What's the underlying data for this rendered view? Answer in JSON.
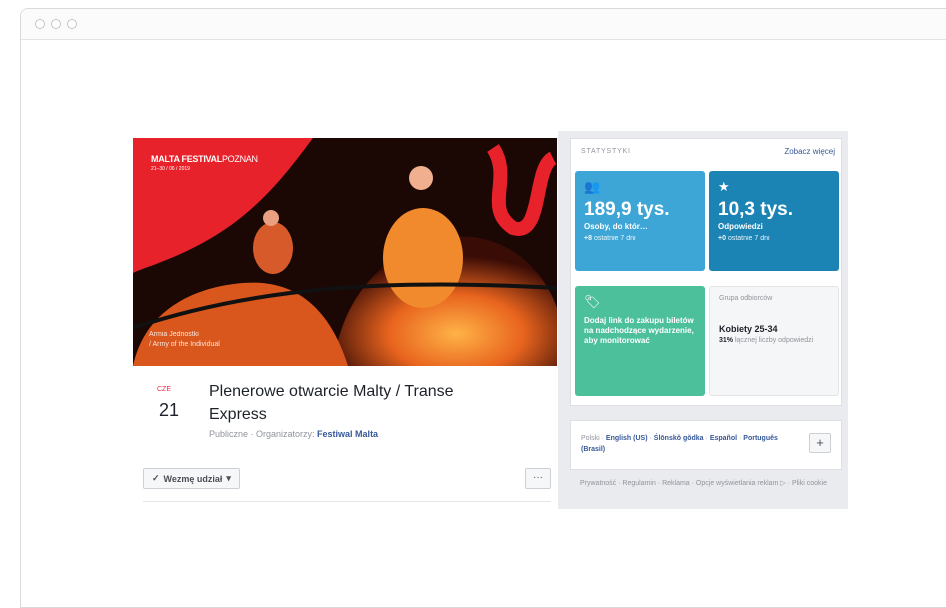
{
  "event": {
    "brand": {
      "bold": "MALTA FESTIVAL",
      "light": "POZNAN",
      "date": "21–30 / 06 / 2019"
    },
    "caption": {
      "line1": "Armia Jednostki",
      "line2": "/ Army of the Individual"
    },
    "date_month": "CZE",
    "date_day": "21",
    "title": "Plenerowe otwarcie Malty / Transe Express",
    "visibility": "Publiczne · Organizatorzy: ",
    "organizer": "Festiwal Malta",
    "attend_label": "Wezmę udział",
    "more_label": "···"
  },
  "stats": {
    "header": "STATYSTYKI",
    "see_more": "Zobacz więcej",
    "reach": {
      "value": "189,9 tys.",
      "label": "Osoby, do któr…",
      "delta": "+8",
      "delta_text": "ostatnie 7 dni"
    },
    "responses": {
      "value": "10,3 tys.",
      "label": "Odpowiedzi",
      "delta": "+0",
      "delta_text": "ostatnie 7 dni"
    },
    "ticket_cta": "Dodaj link do zakupu biletów na nadchodzące wydarzenie, aby monitorować",
    "audience": {
      "head": "Grupa odbiorców",
      "segment": "Kobiety 25-34",
      "pct": "31%",
      "pct_text": "łącznej liczby odpowiedzi"
    }
  },
  "languages": {
    "current": "Polski",
    "options": [
      "English (US)",
      "Ślōnskŏ gŏdka",
      "Español",
      "Português (Brasil)"
    ],
    "add_label": "+"
  },
  "footer": "Prywatność · Regulamin · Reklama · Opcje wyświetlania reklam ▷ · Pliki cookie"
}
